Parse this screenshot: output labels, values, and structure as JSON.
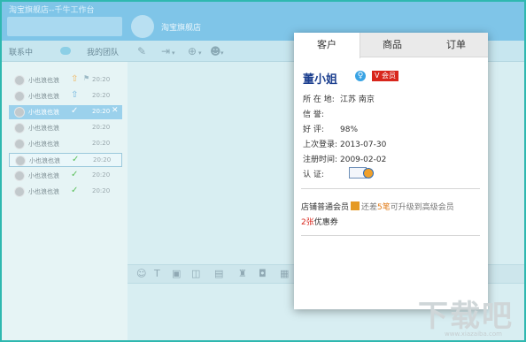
{
  "window": {
    "title": "淘宝旗舰店--千牛工作台",
    "store_name": "淘宝旗舰店"
  },
  "tabs": {
    "contacts": "联系中",
    "team": "我的团队"
  },
  "toolbar_icons": [
    "edit-icon",
    "transfer-icon",
    "add-icon",
    "user-icon"
  ],
  "chat_toolbar_icons": [
    "emoji-icon",
    "font-icon",
    "image-icon",
    "screenshot-icon",
    "phone-icon",
    "audio-icon",
    "gift-icon",
    "more-icon"
  ],
  "contacts": [
    {
      "name": "小也浪也浪",
      "status": "upload",
      "time": "20:20"
    },
    {
      "name": "小也浪也浪",
      "status": "upload-blue",
      "time": "20:20"
    },
    {
      "name": "小也浪也浪",
      "status": "check",
      "time": "20:20",
      "selected": true
    },
    {
      "name": "小也浪也浪",
      "status": "",
      "time": "20:20"
    },
    {
      "name": "小也浪也浪",
      "status": "",
      "time": "20:20"
    },
    {
      "name": "小也浪也浪",
      "status": "check",
      "time": "20:20",
      "hover": true
    },
    {
      "name": "小也浪也浪",
      "status": "check",
      "time": "20:20"
    },
    {
      "name": "小也浪也浪",
      "status": "check",
      "time": "20:20"
    }
  ],
  "popup": {
    "tabs": [
      "客户",
      "商品",
      "订单"
    ],
    "customer": {
      "name": "董小姐",
      "vip_badge": "会员",
      "fields": [
        {
          "label": "所 在 地:",
          "value": "江苏 南京"
        },
        {
          "label": "信     誉:",
          "value": ""
        },
        {
          "label": "好     评:",
          "value": "98%"
        },
        {
          "label": "上次登录:",
          "value": "2013-07-30"
        },
        {
          "label": "注册时间:",
          "value": "2009-02-02"
        },
        {
          "label": "认     证:",
          "value": ""
        }
      ],
      "membership": {
        "level": "店铺普通会员",
        "text1": "还差",
        "count": "5笔",
        "text2": "可升级到高级会员"
      },
      "coupon": {
        "count": "2张",
        "label": "优惠券"
      }
    }
  },
  "colors": {
    "titlebar": "#7fc5e8",
    "selected_row": "#9bd1ec",
    "vip_red": "#d8261c",
    "name_blue": "#1c3f8f"
  },
  "watermark": {
    "text": "下载吧",
    "url": "www.xiazaiba.com"
  }
}
